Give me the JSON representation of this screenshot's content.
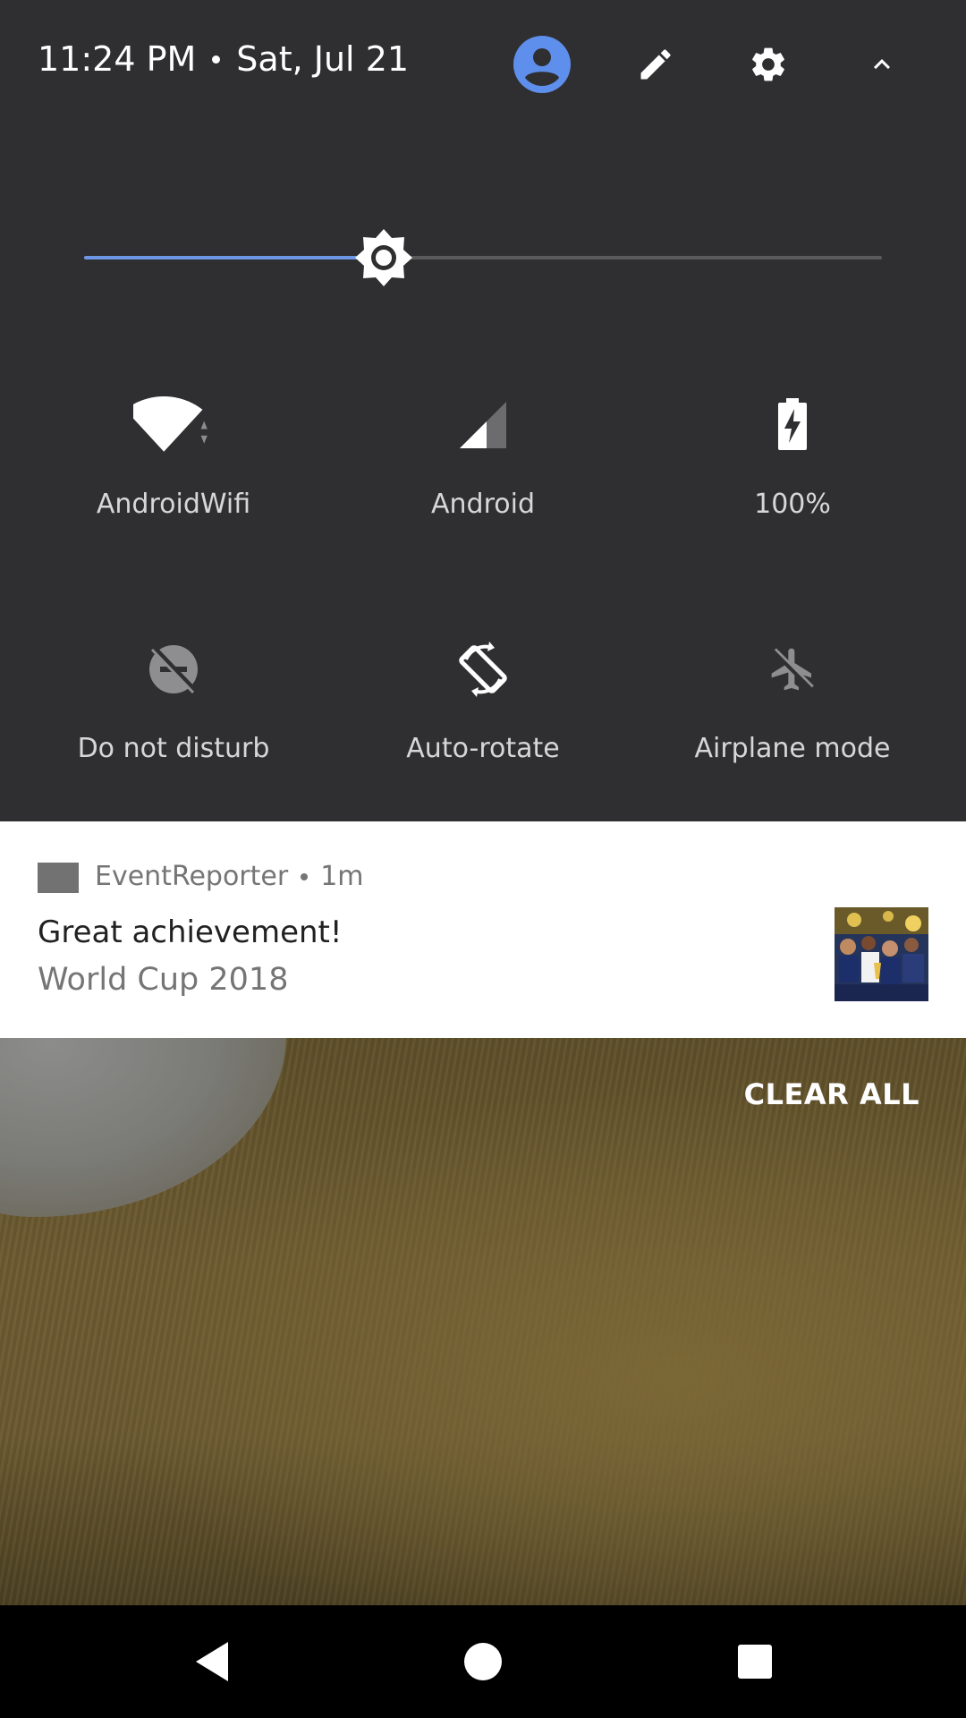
{
  "status": {
    "time": "11:24 PM",
    "date": "Sat, Jul 21"
  },
  "header_icons": [
    "user-icon",
    "edit-icon",
    "settings-icon",
    "collapse-icon"
  ],
  "brightness": {
    "level": 0.375,
    "accent_color": "#6d97e6"
  },
  "tiles": [
    {
      "label": "AndroidWifi",
      "icon": "wifi-icon"
    },
    {
      "label": "Android",
      "icon": "cellular-signal-icon"
    },
    {
      "label": "100%",
      "icon": "battery-charging-icon"
    },
    {
      "label": "Do not disturb",
      "icon": "do-not-disturb-icon"
    },
    {
      "label": "Auto-rotate",
      "icon": "auto-rotate-icon"
    },
    {
      "label": "Airplane mode",
      "icon": "airplane-icon"
    }
  ],
  "notification": {
    "app_name": "EventReporter",
    "time_ago": "1m",
    "title": "Great achievement!",
    "text": "World Cup 2018"
  },
  "clear_all_label": "CLEAR ALL",
  "navbar": [
    "back-icon",
    "home-icon",
    "recents-icon"
  ],
  "colors": {
    "panel_bg": "#2f2f31",
    "user_icon": "#5e8fec",
    "notification_bg": "#ffffff"
  }
}
